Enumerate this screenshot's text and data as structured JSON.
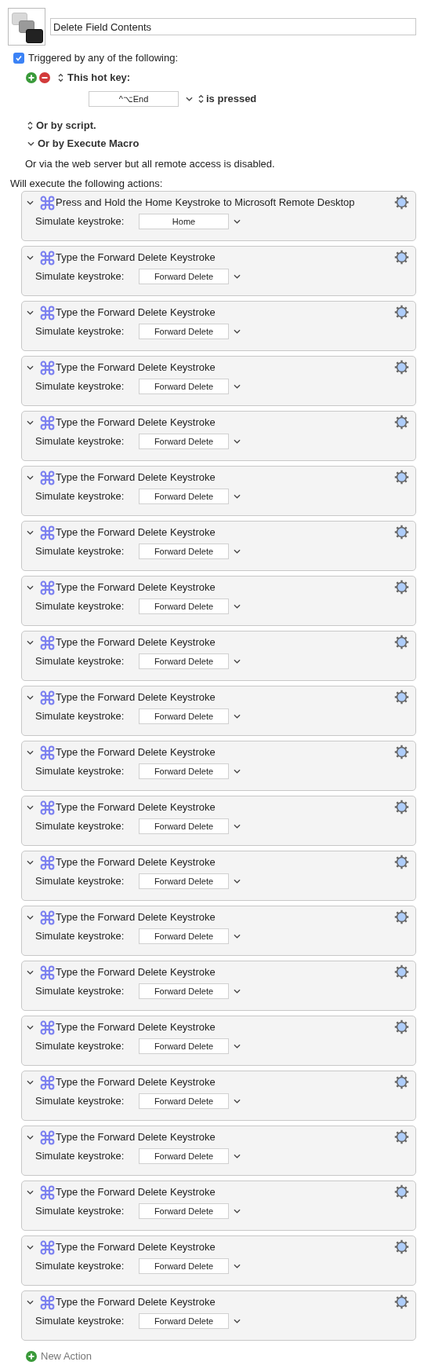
{
  "macro": {
    "name": "Delete Field Contents"
  },
  "trigger": {
    "checked": true,
    "label": "Triggered by any of the following:",
    "hotkey_label": "This hot key:",
    "hotkey": "^⌥End",
    "hotkey_condition": "is pressed",
    "script_label": "Or by script.",
    "execute_label": "Or by Execute Macro",
    "web_note": "Or via the web server but all remote access is disabled."
  },
  "actions_heading": "Will execute the following actions:",
  "actions": [
    {
      "title": "Press and Hold the Home Keystroke to Microsoft Remote Desktop",
      "label": "Simulate keystroke:",
      "key": "Home"
    },
    {
      "title": "Type the Forward Delete Keystroke",
      "label": "Simulate keystroke:",
      "key": "Forward Delete"
    },
    {
      "title": "Type the Forward Delete Keystroke",
      "label": "Simulate keystroke:",
      "key": "Forward Delete"
    },
    {
      "title": "Type the Forward Delete Keystroke",
      "label": "Simulate keystroke:",
      "key": "Forward Delete"
    },
    {
      "title": "Type the Forward Delete Keystroke",
      "label": "Simulate keystroke:",
      "key": "Forward Delete"
    },
    {
      "title": "Type the Forward Delete Keystroke",
      "label": "Simulate keystroke:",
      "key": "Forward Delete"
    },
    {
      "title": "Type the Forward Delete Keystroke",
      "label": "Simulate keystroke:",
      "key": "Forward Delete"
    },
    {
      "title": "Type the Forward Delete Keystroke",
      "label": "Simulate keystroke:",
      "key": "Forward Delete"
    },
    {
      "title": "Type the Forward Delete Keystroke",
      "label": "Simulate keystroke:",
      "key": "Forward Delete"
    },
    {
      "title": "Type the Forward Delete Keystroke",
      "label": "Simulate keystroke:",
      "key": "Forward Delete"
    },
    {
      "title": "Type the Forward Delete Keystroke",
      "label": "Simulate keystroke:",
      "key": "Forward Delete"
    },
    {
      "title": "Type the Forward Delete Keystroke",
      "label": "Simulate keystroke:",
      "key": "Forward Delete"
    },
    {
      "title": "Type the Forward Delete Keystroke",
      "label": "Simulate keystroke:",
      "key": "Forward Delete"
    },
    {
      "title": "Type the Forward Delete Keystroke",
      "label": "Simulate keystroke:",
      "key": "Forward Delete"
    },
    {
      "title": "Type the Forward Delete Keystroke",
      "label": "Simulate keystroke:",
      "key": "Forward Delete"
    },
    {
      "title": "Type the Forward Delete Keystroke",
      "label": "Simulate keystroke:",
      "key": "Forward Delete"
    },
    {
      "title": "Type the Forward Delete Keystroke",
      "label": "Simulate keystroke:",
      "key": "Forward Delete"
    },
    {
      "title": "Type the Forward Delete Keystroke",
      "label": "Simulate keystroke:",
      "key": "Forward Delete"
    },
    {
      "title": "Type the Forward Delete Keystroke",
      "label": "Simulate keystroke:",
      "key": "Forward Delete"
    },
    {
      "title": "Type the Forward Delete Keystroke",
      "label": "Simulate keystroke:",
      "key": "Forward Delete"
    },
    {
      "title": "Type the Forward Delete Keystroke",
      "label": "Simulate keystroke:",
      "key": "Forward Delete"
    }
  ],
  "new_action": "New Action"
}
